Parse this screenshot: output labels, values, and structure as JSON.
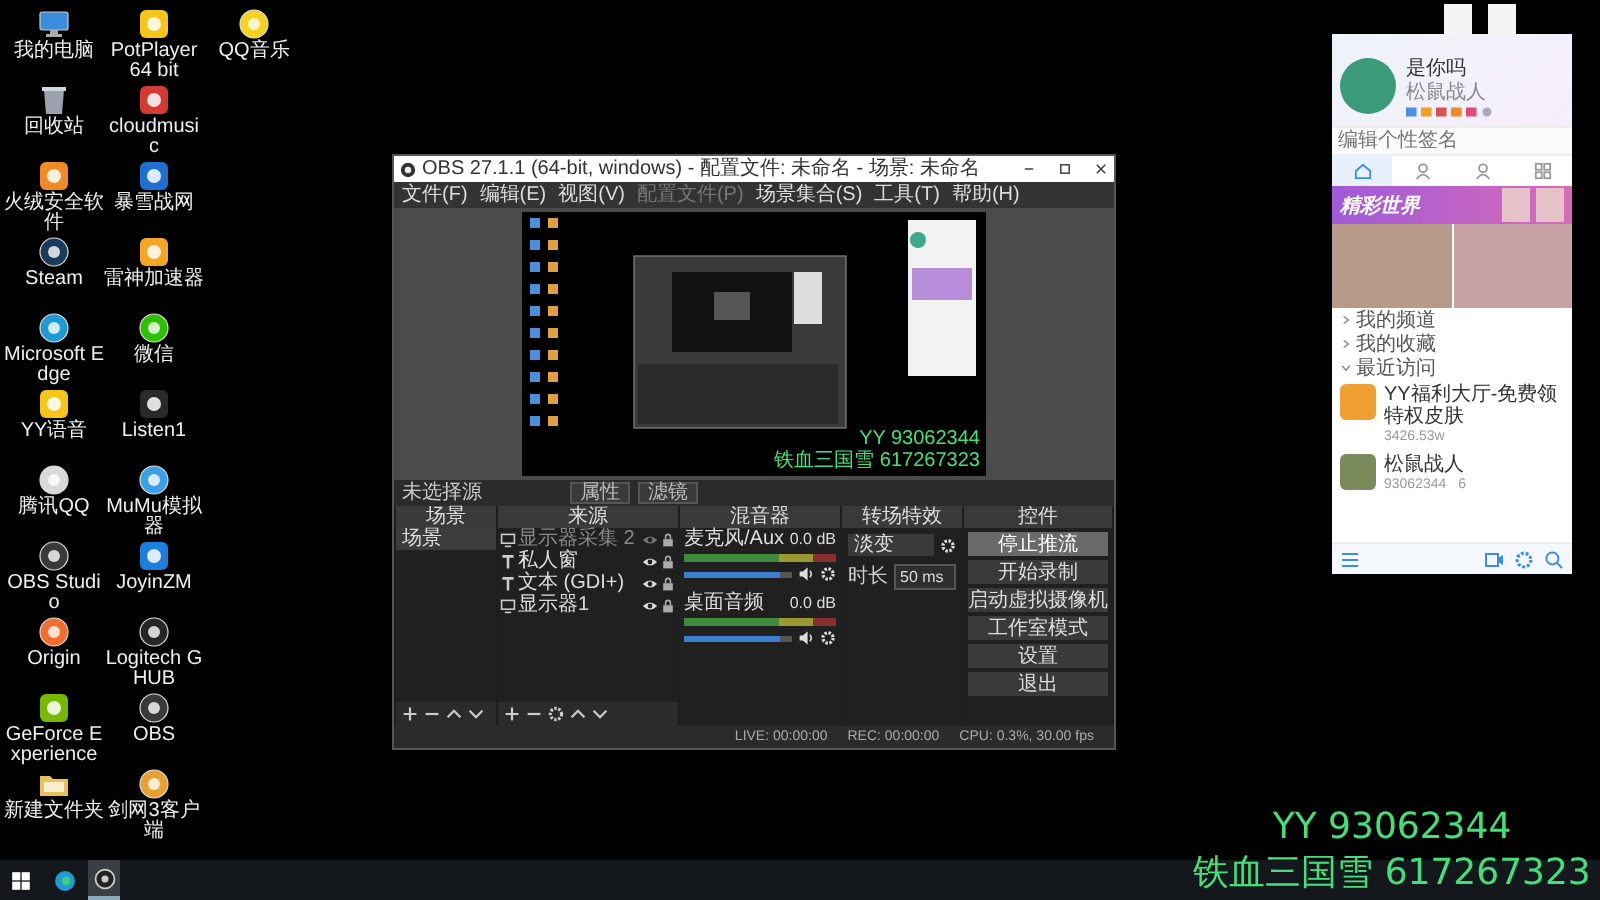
{
  "desktop": {
    "columns": [
      [
        {
          "label": "我的电脑",
          "kind": "computer"
        },
        {
          "label": "回收站",
          "kind": "recycle"
        },
        {
          "label": "火绒安全软件",
          "kind": "huorong"
        },
        {
          "label": "Steam",
          "kind": "steam"
        },
        {
          "label": "Microsoft Edge",
          "kind": "edge"
        },
        {
          "label": "YY语音",
          "kind": "yy"
        },
        {
          "label": "腾讯QQ",
          "kind": "qq"
        },
        {
          "label": "OBS Studio",
          "kind": "obs"
        },
        {
          "label": "Origin",
          "kind": "origin"
        },
        {
          "label": "GeForce Experience",
          "kind": "geforce"
        },
        {
          "label": "新建文件夹",
          "kind": "folder"
        }
      ],
      [
        {
          "label": "PotPlayer 64 bit",
          "kind": "potplayer"
        },
        {
          "label": "cloudmusic",
          "kind": "netease"
        },
        {
          "label": "暴雪战网",
          "kind": "battlenet"
        },
        {
          "label": "雷神加速器",
          "kind": "leishen"
        },
        {
          "label": "微信",
          "kind": "wechat"
        },
        {
          "label": "Listen1",
          "kind": "listen1"
        },
        {
          "label": "MuMu模拟器",
          "kind": "mumu"
        },
        {
          "label": "JoyinZM",
          "kind": "joyin"
        },
        {
          "label": "Logitech G HUB",
          "kind": "ghub"
        },
        {
          "label": "OBS",
          "kind": "obs"
        },
        {
          "label": "剑网3客户端",
          "kind": "jx3"
        }
      ],
      [
        {
          "label": "QQ音乐",
          "kind": "qqmusic"
        }
      ]
    ]
  },
  "obs": {
    "title": "OBS 27.1.1 (64-bit, windows) - 配置文件: 未命名 - 场景: 未命名",
    "menu": [
      {
        "label": "文件(F)",
        "disabled": false
      },
      {
        "label": "编辑(E)",
        "disabled": false
      },
      {
        "label": "视图(V)",
        "disabled": false
      },
      {
        "label": "配置文件(P)",
        "disabled": true
      },
      {
        "label": "场景集合(S)",
        "disabled": false
      },
      {
        "label": "工具(T)",
        "disabled": false
      },
      {
        "label": "帮助(H)",
        "disabled": false
      }
    ],
    "preview": {
      "overlay_lines": [
        "YY 93062344",
        "铁血三国雪 617267323"
      ]
    },
    "source_toolbar": {
      "label": "未选择源",
      "buttons": [
        "属性",
        "滤镜"
      ]
    },
    "scenes": {
      "title": "场景",
      "items": [
        {
          "label": "场景",
          "selected": true
        }
      ]
    },
    "sources": {
      "title": "来源",
      "items": [
        {
          "label": "显示器采集 2",
          "kind": "monitor",
          "visible": false
        },
        {
          "label": "私人窗",
          "kind": "text",
          "visible": true
        },
        {
          "label": "文本 (GDI+)",
          "kind": "text",
          "visible": true
        },
        {
          "label": "显示器1",
          "kind": "monitor",
          "visible": true
        }
      ]
    },
    "mixer": {
      "title": "混音器",
      "channels": [
        {
          "name": "麦克风/Aux",
          "reading": "0.0 dB",
          "level": 0.88
        },
        {
          "name": "桌面音频",
          "reading": "0.0 dB",
          "level": 0.88
        }
      ]
    },
    "transitions": {
      "title": "转场特效",
      "type": "淡变",
      "duration_label": "时长",
      "duration": "50 ms"
    },
    "controls": {
      "title": "控件",
      "buttons": [
        {
          "label": "停止推流",
          "active": true
        },
        {
          "label": "开始录制",
          "active": false
        },
        {
          "label": "启动虚拟摄像机",
          "active": false
        },
        {
          "label": "工作室模式",
          "active": false
        },
        {
          "label": "设置",
          "active": false
        },
        {
          "label": "退出",
          "active": false
        }
      ]
    },
    "status": {
      "live": "LIVE: 00:00:00",
      "rec": "REC: 00:00:00",
      "cpu": "CPU: 0.3%, 30.00 fps"
    }
  },
  "qq": {
    "name": "是你吗",
    "subtitle": "松鼠战人",
    "signature_placeholder": "编辑个性签名",
    "tabs": [
      {
        "kind": "home",
        "selected": true
      },
      {
        "kind": "contacts",
        "selected": false
      },
      {
        "kind": "contacts",
        "selected": false
      },
      {
        "kind": "apps",
        "selected": false
      }
    ],
    "banner": "精彩世界",
    "sections": [
      {
        "label": "我的频道",
        "expanded": false
      },
      {
        "label": "我的收藏",
        "expanded": false
      },
      {
        "label": "最近访问",
        "expanded": true
      }
    ],
    "recent": [
      {
        "title": "YY福利大厅-免费领特权皮肤",
        "stats": [
          "3426.53w"
        ]
      },
      {
        "title": "松鼠战人",
        "stats": [
          "93062344",
          "6"
        ]
      }
    ]
  },
  "overlay": {
    "lines": [
      "YY 93062344",
      "铁血三国雪 617267323"
    ]
  },
  "taskbar": {
    "items": [
      {
        "kind": "start",
        "active": false
      },
      {
        "kind": "edge",
        "active": false
      },
      {
        "kind": "obs",
        "active": true
      }
    ]
  }
}
